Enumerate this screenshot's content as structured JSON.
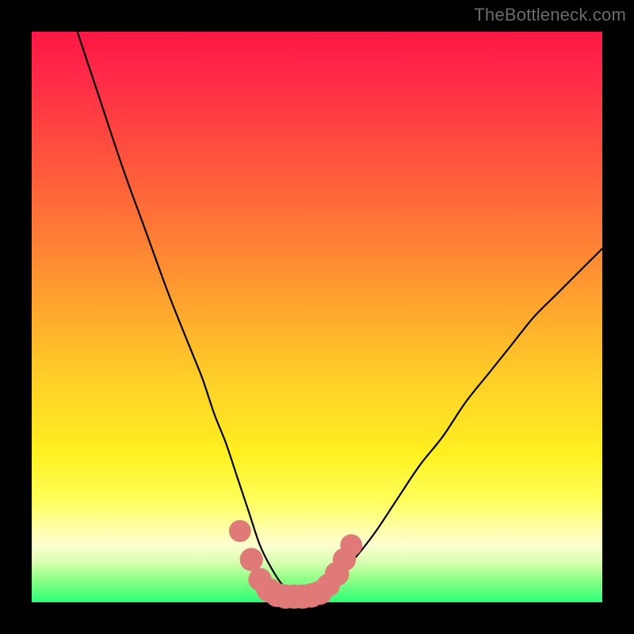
{
  "watermark": "TheBottleneck.com",
  "colors": {
    "frame": "#000000",
    "curve": "#000000",
    "marker_fill": "#e07a78",
    "marker_stroke": "#d86a66",
    "gradient_top": "#ff1846",
    "gradient_bottom": "#2bff77"
  },
  "chart_data": {
    "type": "line",
    "title": "",
    "xlabel": "",
    "ylabel": "",
    "xlim": [
      0,
      100
    ],
    "ylim": [
      0,
      100
    ],
    "grid": false,
    "legend": false,
    "series": [
      {
        "name": "bottleneck-curve",
        "x": [
          8,
          12,
          16,
          20,
          24,
          28,
          30,
          32,
          34,
          36,
          38,
          40,
          42,
          44,
          46,
          48,
          50,
          52,
          56,
          60,
          64,
          68,
          72,
          76,
          80,
          84,
          88,
          92,
          96,
          100
        ],
        "y": [
          100,
          88,
          76,
          65,
          54,
          44,
          39,
          33,
          28,
          22,
          16,
          10,
          6,
          3,
          1.5,
          1,
          1.5,
          3,
          7,
          12,
          18,
          24,
          29,
          35,
          40,
          45,
          50,
          54,
          58,
          62
        ]
      }
    ],
    "markers": [
      {
        "x": 36.5,
        "y": 12.5,
        "r": 1.1
      },
      {
        "x": 38.5,
        "y": 7.5,
        "r": 1.2
      },
      {
        "x": 40.0,
        "y": 4.0,
        "r": 1.2
      },
      {
        "x": 41.5,
        "y": 2.2,
        "r": 1.3
      },
      {
        "x": 43.0,
        "y": 1.3,
        "r": 1.3
      },
      {
        "x": 44.5,
        "y": 1.0,
        "r": 1.3
      },
      {
        "x": 46.0,
        "y": 1.0,
        "r": 1.3
      },
      {
        "x": 47.5,
        "y": 1.0,
        "r": 1.3
      },
      {
        "x": 49.0,
        "y": 1.2,
        "r": 1.3
      },
      {
        "x": 50.5,
        "y": 1.7,
        "r": 1.3
      },
      {
        "x": 52.0,
        "y": 3.0,
        "r": 1.2
      },
      {
        "x": 53.5,
        "y": 5.0,
        "r": 1.3
      },
      {
        "x": 54.8,
        "y": 7.5,
        "r": 1.2
      },
      {
        "x": 56.0,
        "y": 10.0,
        "r": 1.1
      }
    ]
  }
}
